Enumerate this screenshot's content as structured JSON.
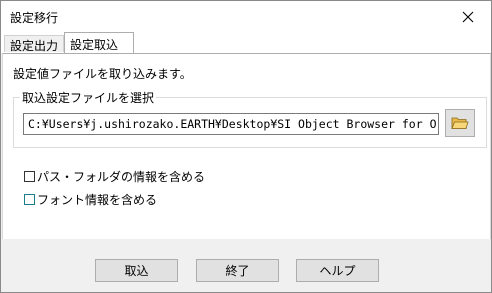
{
  "window": {
    "title": "設定移行",
    "close_icon": "close-icon"
  },
  "tabs": [
    {
      "label": "設定出力",
      "active": false
    },
    {
      "label": "設定取込",
      "active": true
    }
  ],
  "panel": {
    "description": "設定値ファイルを取り込みます。",
    "group_label": "取込設定ファイルを選択",
    "file_path": "C:¥Users¥j.ushirozako.EARTH¥Desktop¥SI Object Browser for Oracle",
    "browse_icon": "folder-icon",
    "options": [
      {
        "label": "パス・フォルダの情報を含める",
        "checked": false
      },
      {
        "label": "フォント情報を含める",
        "checked": false,
        "focused": true
      }
    ]
  },
  "buttons": {
    "import": "取込",
    "exit": "終了",
    "help": "ヘルプ"
  },
  "colors": {
    "dialog_bg": "#f0f0f0",
    "panel_bg": "#ffffff",
    "button_bg": "#e1e1e1",
    "focus_border": "#1a7f8a"
  }
}
